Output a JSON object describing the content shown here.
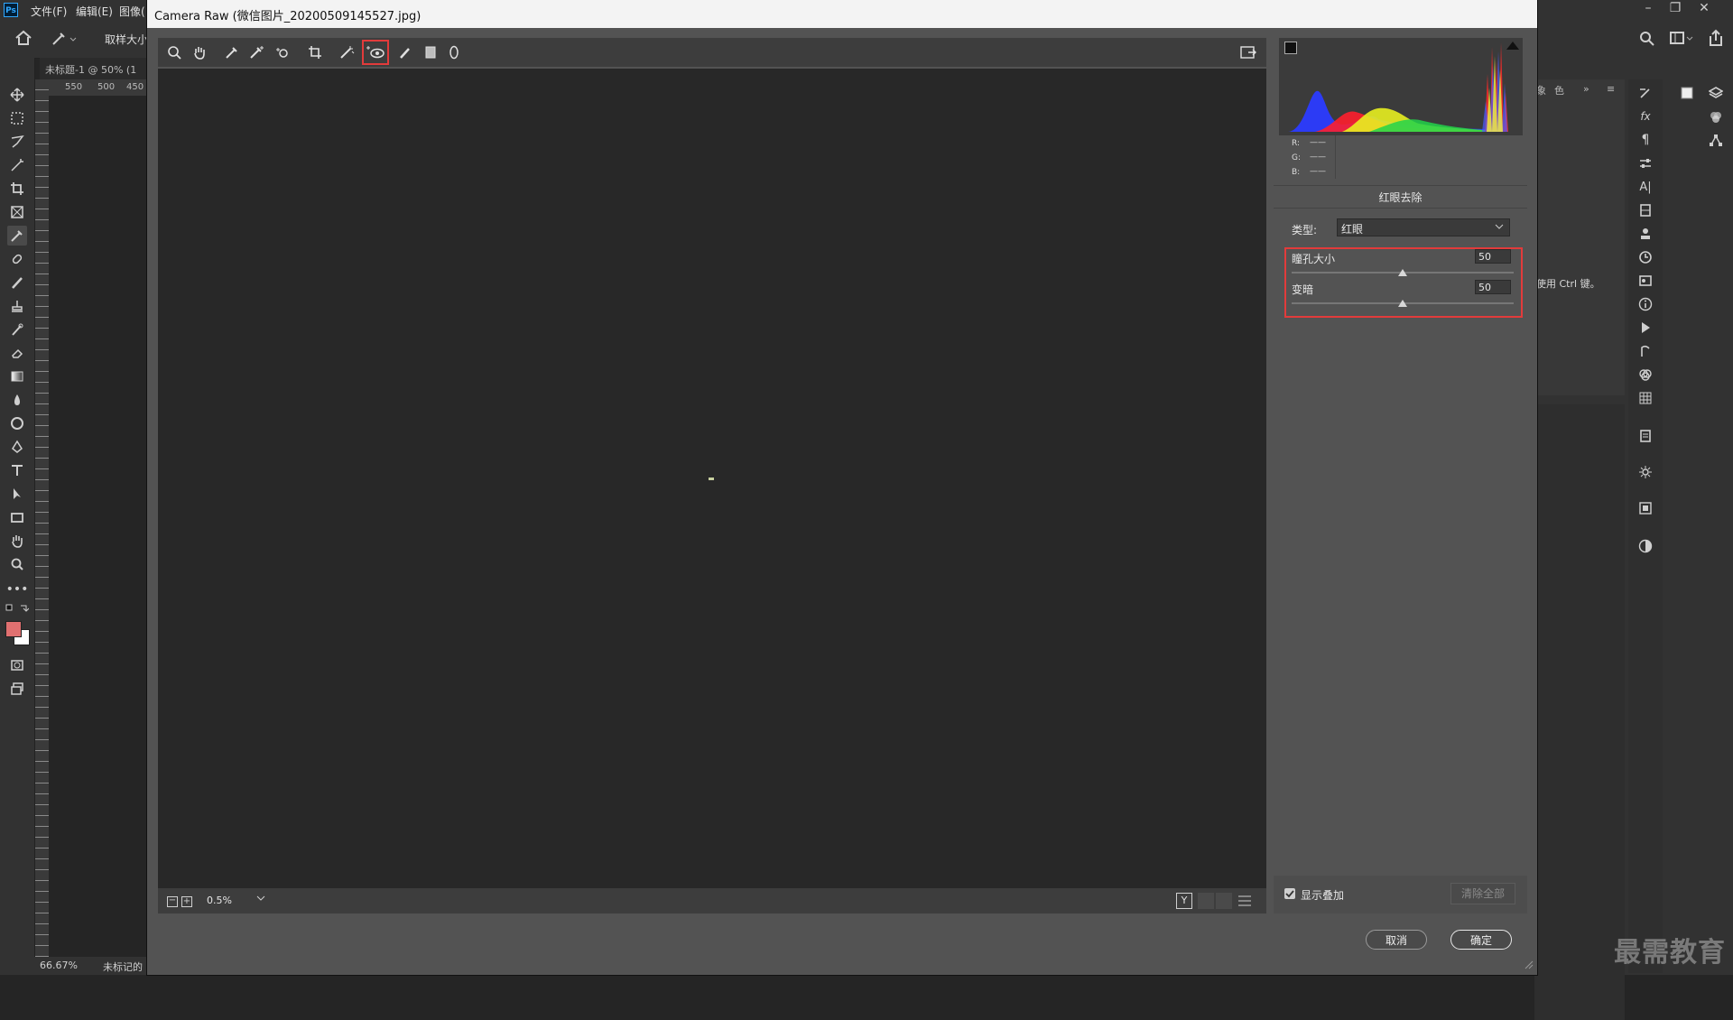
{
  "photoshop": {
    "logo": "Ps",
    "menu": [
      "文件(F)",
      "编辑(E)",
      "图像("
    ],
    "options_sample_label": "取样大小",
    "doc_tab": "未标题-1 @ 50% (1",
    "ruler_ticks": [
      "550",
      "500",
      "450"
    ],
    "status_zoom": "66.67%",
    "status_text": "未标记的",
    "hint_text": "使用 Ctrl 键。",
    "panel_tabs": [
      "象",
      "色"
    ]
  },
  "camera_raw": {
    "title": "Camera Raw (微信图片_20200509145527.jpg)",
    "tools": [
      "zoom-tool",
      "hand-tool",
      "white-balance-tool",
      "color-sampler-tool",
      "targeted-adjustment-tool",
      "straighten-tool",
      "spot-removal-tool",
      "red-eye-removal-tool",
      "adjustment-brush-tool",
      "graduated-filter-tool",
      "radial-filter-tool"
    ],
    "selected_tool": "red-eye-removal-tool",
    "rgb_readout": {
      "r_label": "R:",
      "g_label": "G:",
      "b_label": "B:",
      "r": "——",
      "g": "——",
      "b": "——"
    },
    "panel_title": "红眼去除",
    "type_label": "类型:",
    "type_value": "红眼",
    "pupil_size_label": "瞳孔大小",
    "pupil_size_value": "50",
    "darken_label": "变暗",
    "darken_value": "50",
    "zoom_value": "0.5%",
    "show_overlay_label": "显示叠加",
    "show_overlay_checked": true,
    "clear_all_label": "清除全部",
    "cancel_label": "取消",
    "ok_label": "确定",
    "highlight_color": "#e23b3b"
  },
  "watermark": "最需教育"
}
